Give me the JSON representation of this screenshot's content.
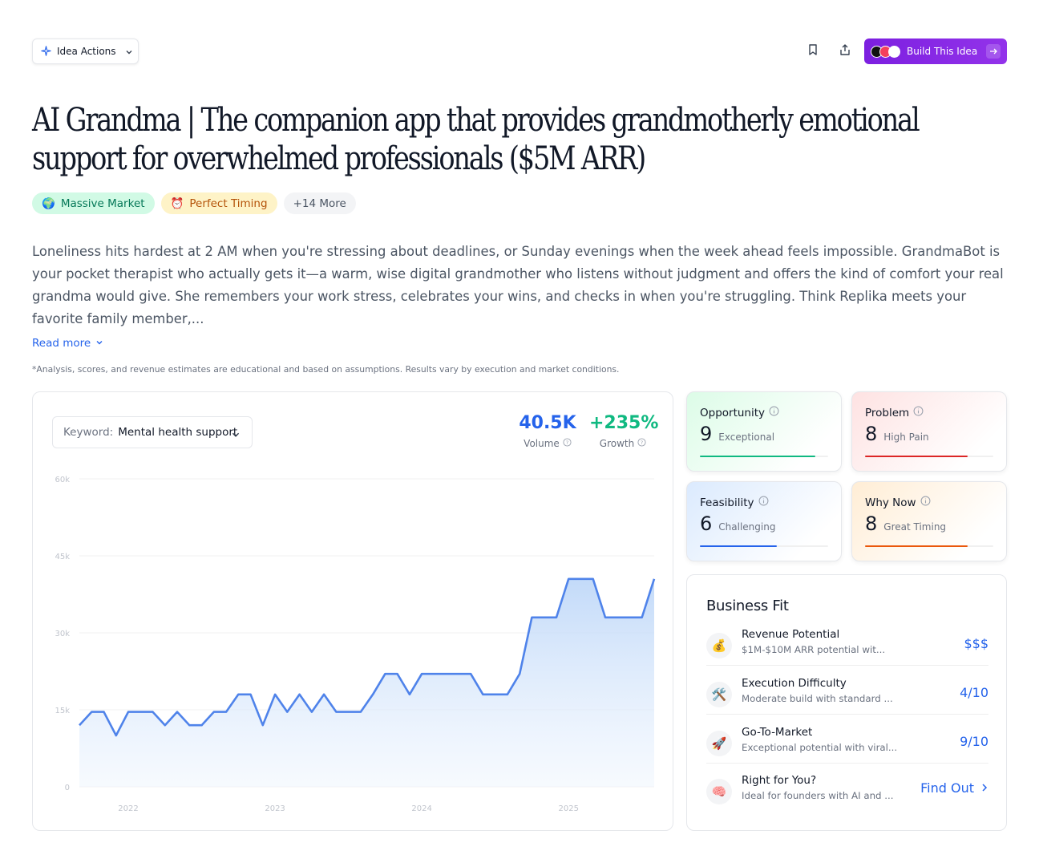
{
  "toolbar": {
    "idea_actions_label": "Idea Actions",
    "build_label": "Build This Idea",
    "build_logos": [
      "rork",
      "lovable",
      "v0"
    ]
  },
  "title": "AI Grandma | The companion app that provides grandmotherly emotional support for overwhelmed professionals ($5M ARR)",
  "tags": [
    {
      "emoji": "🌍",
      "label": "Massive Market"
    },
    {
      "emoji": "⏰",
      "label": "Perfect Timing"
    },
    {
      "emoji": "",
      "label": "+14 More"
    }
  ],
  "description": "Loneliness hits hardest at 2 AM when you're stressing about deadlines, or Sunday evenings when the week ahead feels impossible. GrandmaBot is your pocket therapist who actually gets it—a warm, wise digital grandmother who listens without judgment and offers the kind of comfort your real grandma would give. She remembers your work stress, celebrates your wins, and checks in when you're struggling. Think Replika meets your favorite family member,...",
  "read_more_label": "Read more",
  "disclaimer": "*Analysis, scores, and revenue estimates are educational and based on assumptions. Results vary by execution and market conditions.",
  "keyword": {
    "label": "Keyword:",
    "value": "Mental health support"
  },
  "stats": {
    "volume_value": "40.5K",
    "volume_label": "Volume",
    "growth_value": "+235%",
    "growth_label": "Growth"
  },
  "colors": {
    "accent": "#2563eb",
    "growth": "#10b981",
    "line": "#4f83ea",
    "build": "#8b22e6"
  },
  "chart_data": {
    "type": "area",
    "ylim": [
      0,
      60000
    ],
    "y_ticks": [
      "0",
      "15k",
      "30k",
      "45k",
      "60k"
    ],
    "x_ticks": [
      "2022",
      "2023",
      "2024",
      "2025"
    ],
    "x_tick_index": [
      4,
      16,
      28,
      40
    ],
    "values": [
      12000,
      14600,
      14600,
      10000,
      14600,
      14600,
      14600,
      12000,
      14600,
      12000,
      12000,
      14600,
      14600,
      18000,
      18000,
      12000,
      18000,
      14600,
      18000,
      14600,
      18000,
      14600,
      14600,
      14600,
      18000,
      22000,
      22000,
      18000,
      22000,
      22000,
      22000,
      22000,
      22000,
      18000,
      18000,
      18000,
      22000,
      33000,
      33000,
      33000,
      40500,
      40500,
      40500,
      33000,
      33000,
      33000,
      33000,
      40500
    ]
  },
  "scores": [
    {
      "title": "Opportunity",
      "value": "9",
      "label": "Exceptional",
      "fill": 0.9,
      "color": "#10b981"
    },
    {
      "title": "Problem",
      "value": "8",
      "label": "High Pain",
      "fill": 0.8,
      "color": "#dc2626"
    },
    {
      "title": "Feasibility",
      "value": "6",
      "label": "Challenging",
      "fill": 0.6,
      "color": "#2563eb"
    },
    {
      "title": "Why Now",
      "value": "8",
      "label": "Great Timing",
      "fill": 0.8,
      "color": "#ea580c"
    }
  ],
  "business_fit": {
    "title": "Business Fit",
    "rows": [
      {
        "icon": "💰",
        "name": "Revenue Potential",
        "detail": "$1M-$10M ARR potential wit...",
        "value": "$$$"
      },
      {
        "icon": "🛠️",
        "name": "Execution Difficulty",
        "detail": "Moderate build with standard ...",
        "value": "4/10"
      },
      {
        "icon": "🚀",
        "name": "Go-To-Market",
        "detail": "Exceptional potential with viral...",
        "value": "9/10"
      },
      {
        "icon": "🧠",
        "name": "Right for You?",
        "detail": "Ideal for founders with AI and ...",
        "value": "Find Out"
      }
    ]
  }
}
